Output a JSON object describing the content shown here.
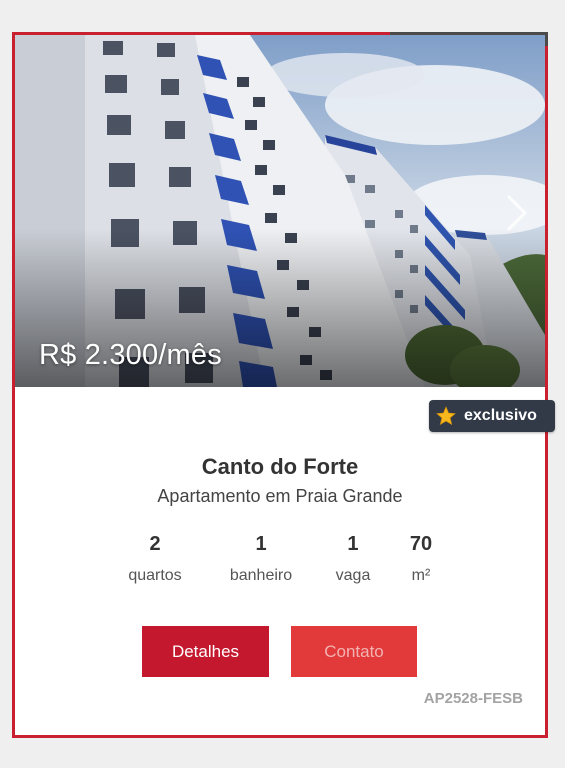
{
  "listing": {
    "price": "R$ 2.300/mês",
    "badge": "exclusivo",
    "title": "Canto do Forte",
    "subtitle": "Apartamento em Praia Grande",
    "features": [
      {
        "value": "2",
        "label": "quartos"
      },
      {
        "value": "1",
        "label": "banheiro"
      },
      {
        "value": "1",
        "label": "vaga"
      },
      {
        "value": "70",
        "label": "m²"
      }
    ],
    "details_label": "Detalhes",
    "contact_label": "Contato",
    "code": "AP2528-FESB"
  },
  "icons": {
    "next": "chevron-right-icon",
    "badge": "star-icon"
  },
  "colors": {
    "brand_red": "#c4182f",
    "contact_red": "#e23a3a",
    "border_red": "#c9202f",
    "badge_bg": "#323a48"
  }
}
